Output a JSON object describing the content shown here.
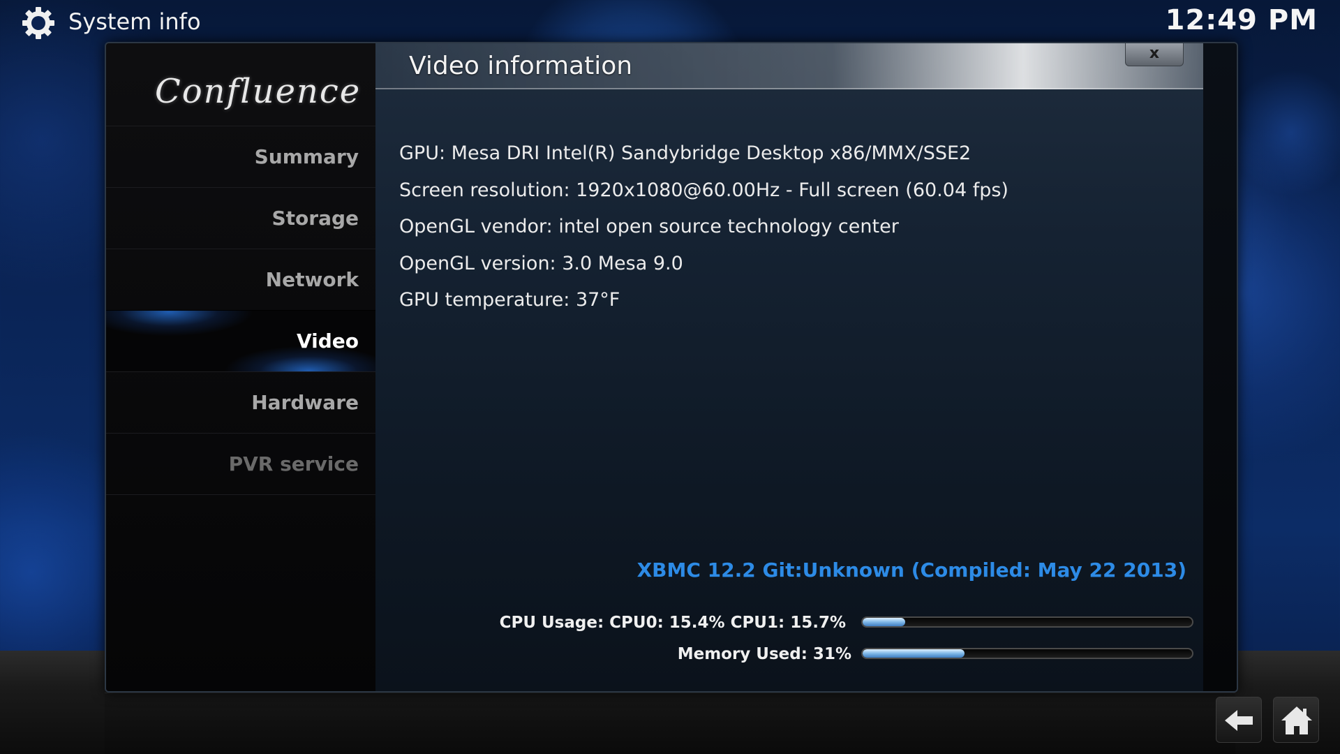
{
  "topbar": {
    "icon": "gear-icon",
    "title": "System info",
    "clock": "12:49 PM"
  },
  "sidebar": {
    "logo_text": "Confluence",
    "items": [
      {
        "label": "Summary",
        "state": "normal"
      },
      {
        "label": "Storage",
        "state": "normal"
      },
      {
        "label": "Network",
        "state": "normal"
      },
      {
        "label": "Video",
        "state": "active"
      },
      {
        "label": "Hardware",
        "state": "normal"
      },
      {
        "label": "PVR service",
        "state": "disabled"
      }
    ]
  },
  "header": {
    "title": "Video information",
    "close_label": "x"
  },
  "info": {
    "lines": [
      "GPU: Mesa DRI Intel(R) Sandybridge Desktop x86/MMX/SSE2",
      "Screen resolution: 1920x1080@60.00Hz - Full screen (60.04 fps)",
      "OpenGL vendor: intel open source technology center",
      "OpenGL version: 3.0 Mesa 9.0",
      "GPU temperature: 37°F"
    ]
  },
  "footer": {
    "version": "XBMC 12.2 Git:Unknown (Compiled: May 22 2013)",
    "cpu": {
      "label": "CPU Usage: CPU0: 15.4% CPU1: 15.7%",
      "fill_percent": 13
    },
    "memory": {
      "label": "Memory Used: 31%",
      "fill_percent": 31
    }
  },
  "nav": {
    "back_icon": "back-arrow-icon",
    "home_icon": "home-icon"
  },
  "colors": {
    "accent": "#2d8be6",
    "background": "#0a2456"
  }
}
